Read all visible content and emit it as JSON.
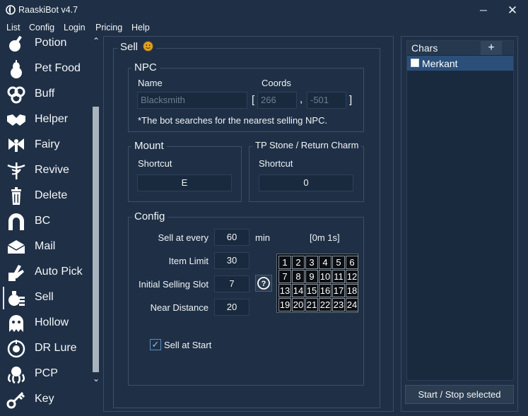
{
  "window": {
    "title": "RaaskiBot v4.7",
    "minimize_glyph": "─",
    "close_glyph": "✕"
  },
  "menu": [
    "List",
    "Config",
    "Login",
    "Pricing",
    "Help"
  ],
  "sidebar": {
    "items": [
      {
        "label": "Potion",
        "icon": "potion-icon"
      },
      {
        "label": "Pet Food",
        "icon": "pear-icon"
      },
      {
        "label": "Buff",
        "icon": "swirl-icon"
      },
      {
        "label": "Helper",
        "icon": "handshake-icon"
      },
      {
        "label": "Fairy",
        "icon": "fairy-icon"
      },
      {
        "label": "Revive",
        "icon": "caduceus-icon"
      },
      {
        "label": "Delete",
        "icon": "trash-icon"
      },
      {
        "label": "BC",
        "icon": "magnet-icon"
      },
      {
        "label": "Mail",
        "icon": "envelope-icon"
      },
      {
        "label": "Auto Pick",
        "icon": "grab-hand-icon"
      },
      {
        "label": "Sell",
        "icon": "money-sack-icon"
      },
      {
        "label": "Hollow",
        "icon": "ghost-icon"
      },
      {
        "label": "DR Lure",
        "icon": "lure-icon"
      },
      {
        "label": "PCP",
        "icon": "octopus-icon"
      },
      {
        "label": "Key",
        "icon": "key-icon"
      }
    ],
    "active": "Sell"
  },
  "sell": {
    "title": "Sell",
    "npc": {
      "title": "NPC",
      "name_label": "Name",
      "coords_label": "Coords",
      "name_value": "Blacksmith",
      "bracket_open": "[",
      "x_value": "266",
      "comma": ",",
      "y_value": "-501",
      "bracket_close": "]",
      "note": "*The bot searches for the nearest selling NPC."
    },
    "mount": {
      "title": "Mount",
      "shortcut_label": "Shortcut",
      "shortcut_value": "E"
    },
    "tp": {
      "title": "TP Stone / Return Charm",
      "shortcut_label": "Shortcut",
      "shortcut_value": "0"
    },
    "config": {
      "title": "Config",
      "sell_every_label": "Sell at every",
      "sell_every_value": "60",
      "min_label": "min",
      "timer": "[0m 1s]",
      "item_limit_label": "Item Limit",
      "item_limit_value": "30",
      "initial_slot_label": "Initial Selling Slot",
      "initial_slot_value": "7",
      "near_distance_label": "Near Distance",
      "near_distance_value": "20",
      "help_glyph": "?",
      "sell_at_start_label": "Sell at Start",
      "sell_at_start_checked": true,
      "check_glyph": "✓",
      "slots": [
        "1",
        "2",
        "3",
        "4",
        "5",
        "6",
        "7",
        "8",
        "9",
        "10",
        "11",
        "12",
        "13",
        "14",
        "15",
        "16",
        "17",
        "18",
        "19",
        "20",
        "21",
        "22",
        "23",
        "24"
      ]
    }
  },
  "chars": {
    "header": "Chars",
    "add_glyph": "+",
    "items": [
      {
        "name": "Merkant",
        "checked": false
      }
    ],
    "start_stop_label": "Start / Stop selected"
  },
  "scroll": {
    "up_glyph": "⌃",
    "down_glyph": "⌄"
  }
}
